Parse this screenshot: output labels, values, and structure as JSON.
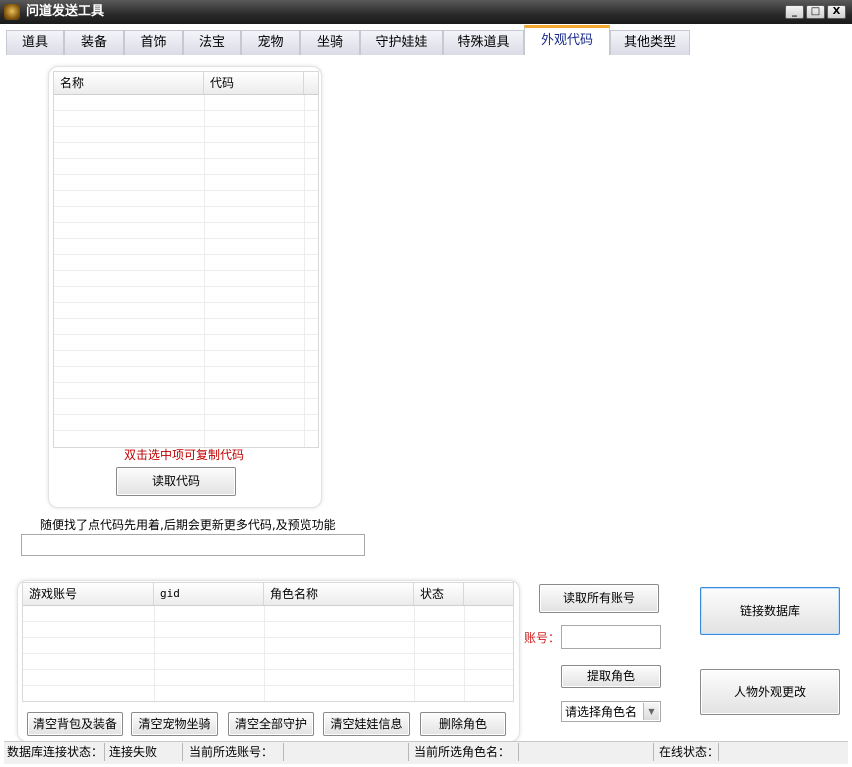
{
  "window": {
    "title": "问道发送工具",
    "controls": {
      "minimize": "_",
      "maximize": "□",
      "close": "X"
    }
  },
  "tabs": [
    {
      "label": "道具",
      "active": false
    },
    {
      "label": "装备",
      "active": false
    },
    {
      "label": "首饰",
      "active": false
    },
    {
      "label": "法宝",
      "active": false
    },
    {
      "label": "宠物",
      "active": false
    },
    {
      "label": "坐骑",
      "active": false
    },
    {
      "label": "守护娃娃",
      "active": false
    },
    {
      "label": "特殊道具",
      "active": false
    },
    {
      "label": "外观代码",
      "active": true
    },
    {
      "label": "其他类型",
      "active": false
    }
  ],
  "code_panel": {
    "columns": [
      "名称",
      "代码"
    ],
    "hint": "双击选中项可复制代码",
    "read_button": "读取代码"
  },
  "notice": "随便找了点代码先用着,后期会更新更多代码,及预览功能",
  "notice_field_value": "",
  "account_panel": {
    "columns": [
      "游戏账号",
      "gid",
      "角色名称",
      "状态"
    ],
    "buttons": {
      "clear_bag": "清空背包及装备",
      "clear_pet": "清空宠物坐骑",
      "clear_guard": "清空全部守护",
      "clear_doll": "清空娃娃信息",
      "delete_role": "删除角色"
    }
  },
  "controls": {
    "read_all_accounts": "读取所有账号",
    "account_label": "账号：",
    "account_value": "",
    "fetch_role": "提取角色",
    "role_select": "请选择角色名",
    "link_db": "链接数据库",
    "change_appearance": "人物外观更改"
  },
  "status": {
    "db_label": "数据库连接状态：",
    "db_value": "连接失败",
    "account_label": "当前所选账号：",
    "role_label": "当前所选角色名：",
    "online_label": "在线状态："
  },
  "colors": {
    "hint_red": "#c00000",
    "account_label_red": "#d02020",
    "active_tab_accent": "#f0a830"
  }
}
